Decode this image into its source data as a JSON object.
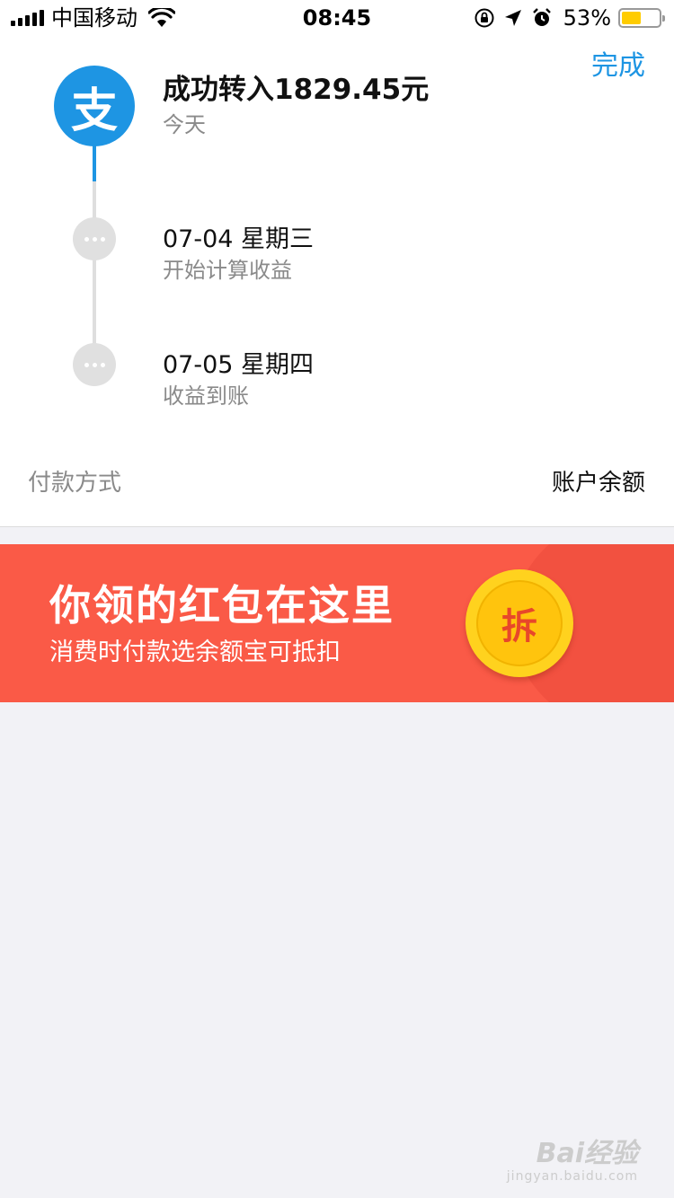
{
  "status_bar": {
    "carrier": "中国移动",
    "time": "08:45",
    "battery_percent": "53%",
    "battery_level": 0.53,
    "icons": [
      "signal-icon",
      "wifi-icon",
      "rotation-lock-icon",
      "location-arrow-icon",
      "alarm-icon",
      "battery-icon"
    ]
  },
  "header": {
    "done_label": "完成",
    "logo_char": "支"
  },
  "timeline": {
    "title": "成功转入1829.45元",
    "title_sub": "今天",
    "steps": [
      {
        "title": "07-04 星期三",
        "sub": "开始计算收益"
      },
      {
        "title": "07-05 星期四",
        "sub": "收益到账"
      }
    ]
  },
  "payment": {
    "label": "付款方式",
    "value": "账户余额"
  },
  "banner": {
    "title": "你领的红包在这里",
    "subtitle": "消费时付款选余额宝可抵扣",
    "coin_label": "拆"
  },
  "watermark": {
    "main": "Bai经验",
    "sub": "jingyan.baidu.com"
  },
  "colors": {
    "accent": "#1e95e3",
    "banner_red": "#fa5a47",
    "coin_yellow": "#ffc40d"
  }
}
